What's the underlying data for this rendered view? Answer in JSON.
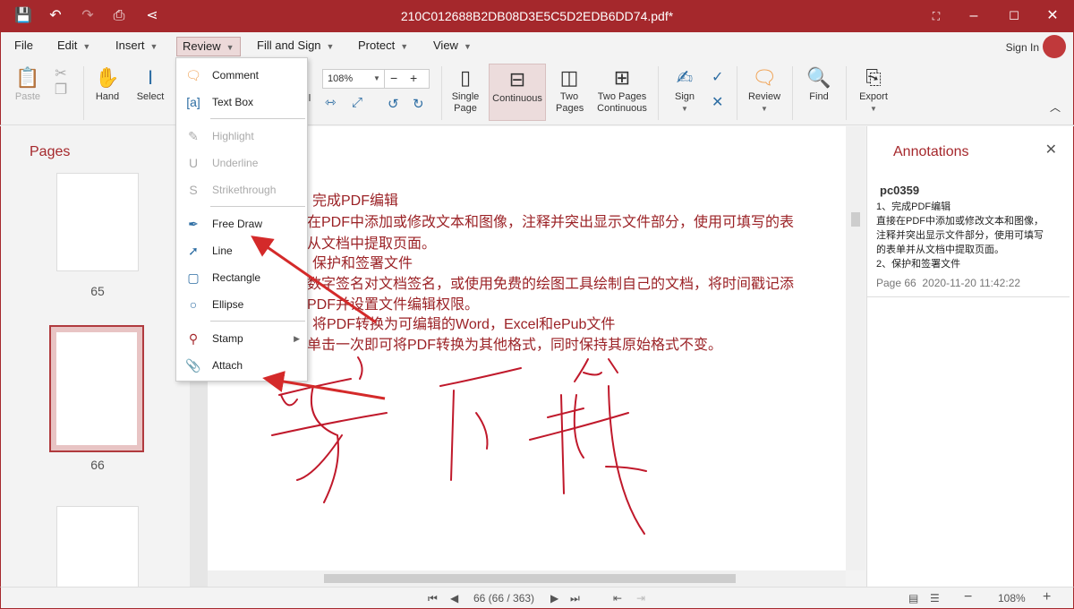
{
  "window": {
    "title": "210C012688B2DB08D3E5C5D2EDB6DD74.pdf*"
  },
  "menubar": {
    "items": [
      "File",
      "Edit",
      "Insert",
      "Review",
      "Fill and Sign",
      "Protect",
      "View"
    ],
    "sign_in": "Sign In"
  },
  "ribbon": {
    "paste": "Paste",
    "hand": "Hand",
    "select": "Select",
    "zoom": "108%",
    "single_page": "Single Page",
    "continuous": "Continuous",
    "two_pages": "Two Pages",
    "two_pages_continuous": "Two Pages Continuous",
    "sign": "Sign",
    "review": "Review",
    "find": "Find",
    "export": "Export",
    "partial_label": "l"
  },
  "review_menu": {
    "items": [
      {
        "label": "Comment",
        "icon": "comment-icon",
        "enabled": true
      },
      {
        "label": "Text Box",
        "icon": "text-box-icon",
        "enabled": true
      },
      {
        "label": "Highlight",
        "icon": "highlight-icon",
        "enabled": false
      },
      {
        "label": "Underline",
        "icon": "underline-icon",
        "enabled": false
      },
      {
        "label": "Strikethrough",
        "icon": "strikethrough-icon",
        "enabled": false
      },
      {
        "label": "Free Draw",
        "icon": "pen-icon",
        "enabled": true
      },
      {
        "label": "Line",
        "icon": "line-icon",
        "enabled": true
      },
      {
        "label": "Rectangle",
        "icon": "rectangle-icon",
        "enabled": true
      },
      {
        "label": "Ellipse",
        "icon": "ellipse-icon",
        "enabled": true
      },
      {
        "label": "Stamp",
        "icon": "stamp-icon",
        "enabled": true
      },
      {
        "label": "Attach",
        "icon": "paperclip-icon",
        "enabled": true
      }
    ]
  },
  "pages_panel": {
    "title": "Pages",
    "pages": [
      "65",
      "66"
    ]
  },
  "document": {
    "lines": [
      "完成PDF编辑",
      "接在PDF中添加或修改文本和图像，注释并突出显示文件部分，使用可填写的表",
      "并从文档中提取页面。",
      "保护和签署文件",
      "用数字签名对文档签名，或使用免费的绘图工具绘制自己的文档，将时间戳记添",
      "到PDF并设置文件编辑权限。",
      "将PDF转换为可编辑的Word，Excel和ePub文件",
      "需单击一次即可将PDF转换为其他格式，同时保持其原始格式不变。"
    ],
    "ink_color": "#c0192b"
  },
  "annotations": {
    "title": "Annotations",
    "items": [
      {
        "author": "pc0359",
        "text": "1、完成PDF编辑\n直接在PDF中添加或修改文本和图像，\n注释并突出显示文件部分，使用可填写\n的表单并从文档中提取页面。\n2、保护和签署文件",
        "page": "Page 66",
        "date": "2020-11-20 11:42:22"
      }
    ]
  },
  "status": {
    "page": "66 (66 / 363)",
    "zoom": "108%"
  },
  "colors": {
    "accent": "#a5282c"
  }
}
